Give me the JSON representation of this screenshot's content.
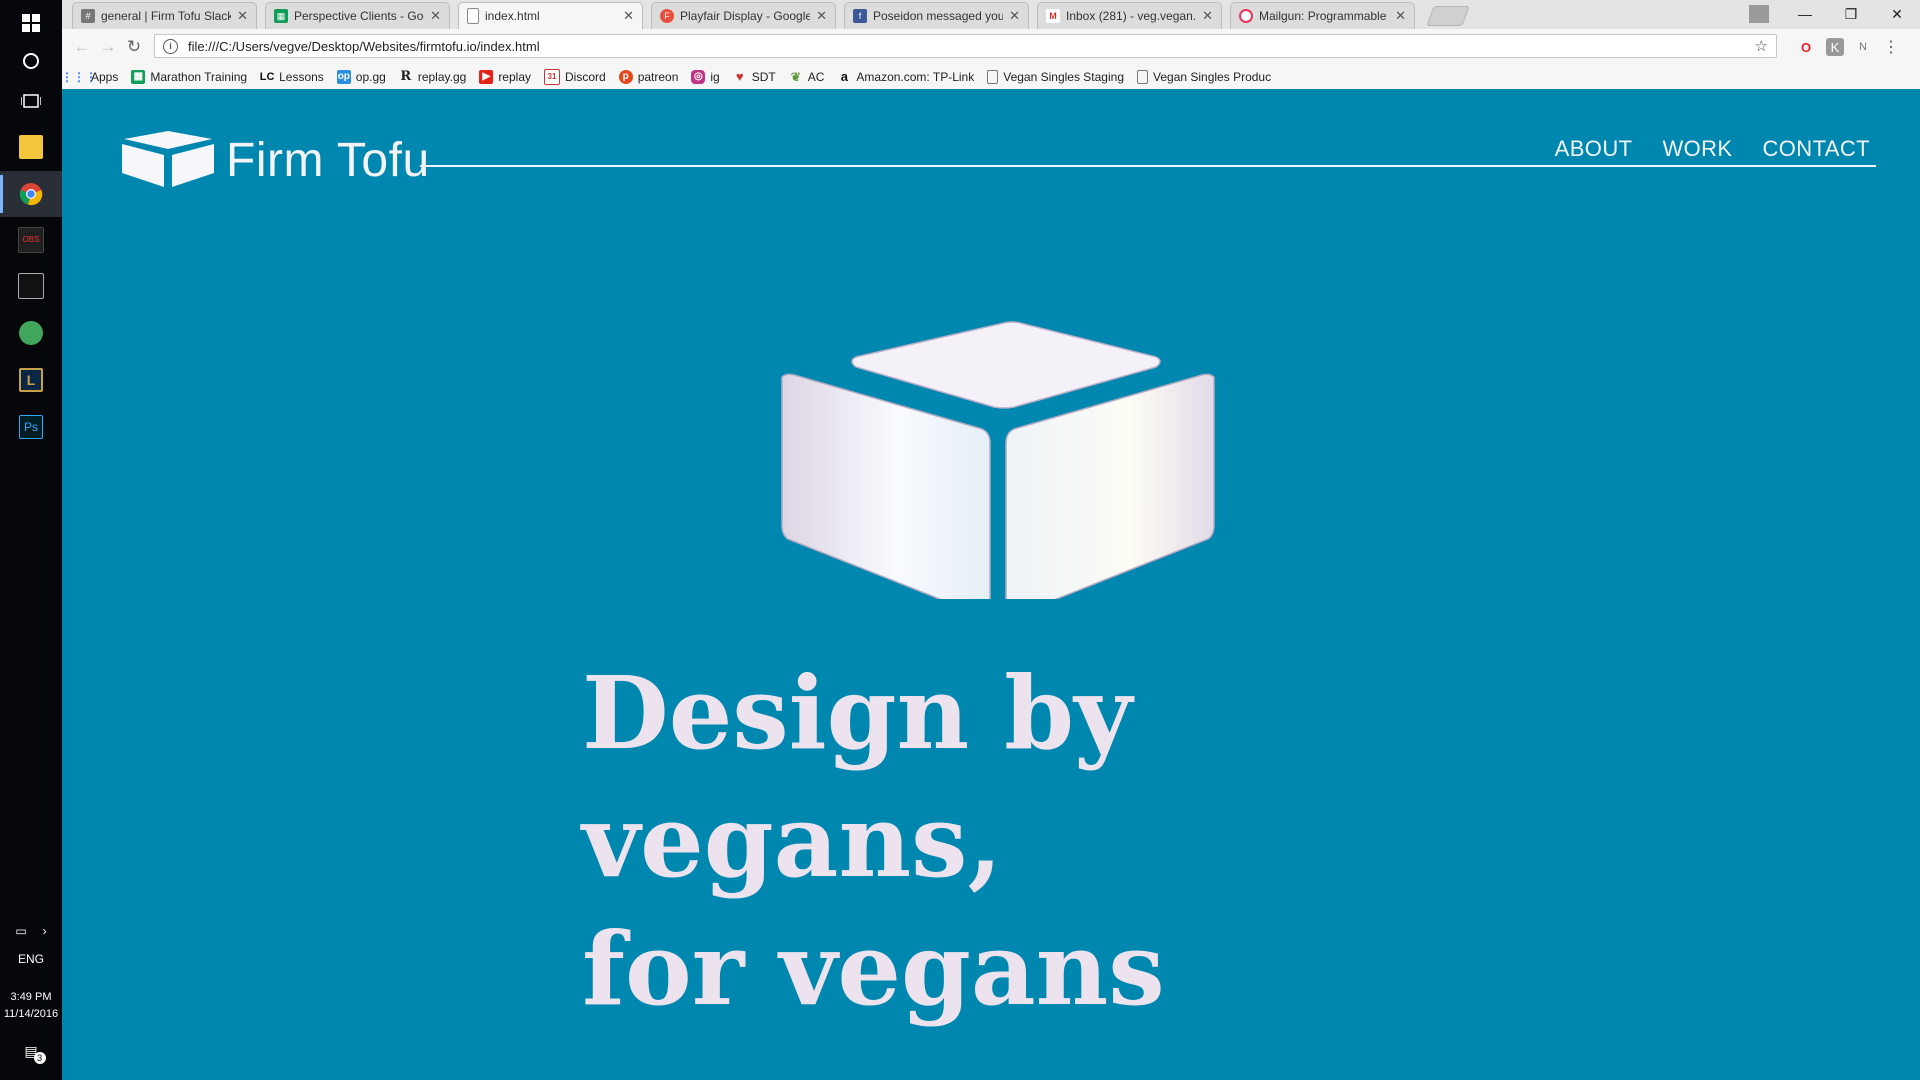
{
  "taskbar": {
    "tray": {
      "language": "ENG",
      "time": "3:49 PM",
      "date": "11/14/2016",
      "notification_count": "3"
    }
  },
  "browser": {
    "tabs": [
      {
        "title": "general | Firm Tofu Slack",
        "favicon": "slack-hash-icon",
        "active": false
      },
      {
        "title": "Perspective Clients - Goo",
        "favicon": "google-sheets-icon",
        "active": false
      },
      {
        "title": "index.html",
        "favicon": "file-icon",
        "active": true
      },
      {
        "title": "Playfair Display - Google",
        "favicon": "google-fonts-icon",
        "active": false
      },
      {
        "title": "Poseidon messaged you",
        "favicon": "facebook-icon",
        "active": false
      },
      {
        "title": "Inbox (281) - veg.vegan.",
        "favicon": "gmail-icon",
        "active": false
      },
      {
        "title": "Mailgun: Programmable",
        "favicon": "mailgun-icon",
        "active": false
      }
    ],
    "url": "file:///C:/Users/vegve/Desktop/Websites/firmtofu.io/index.html",
    "bookmarks": [
      {
        "label": "Apps",
        "icon": "apps-grid-icon"
      },
      {
        "label": "Marathon Training",
        "icon": "sheets-icon"
      },
      {
        "label": "Lessons",
        "icon": "lc-icon"
      },
      {
        "label": "op.gg",
        "icon": "opgg-icon"
      },
      {
        "label": "replay.gg",
        "icon": "replay-r-icon"
      },
      {
        "label": "replay",
        "icon": "youtube-icon"
      },
      {
        "label": "Discord",
        "icon": "calendar-icon"
      },
      {
        "label": "patreon",
        "icon": "patreon-icon"
      },
      {
        "label": "ig",
        "icon": "instagram-icon"
      },
      {
        "label": "SDT",
        "icon": "heart-icon"
      },
      {
        "label": "AC",
        "icon": "leaf-icon"
      },
      {
        "label": "Amazon.com: TP-Link",
        "icon": "amazon-icon"
      },
      {
        "label": "Vegan Singles Staging",
        "icon": "page-icon"
      },
      {
        "label": "Vegan Singles Produc",
        "icon": "page-icon"
      }
    ]
  },
  "site": {
    "brand": "Firm Tofu",
    "nav": [
      "ABOUT",
      "WORK",
      "CONTACT"
    ],
    "headline_line1": "Design by vegans,",
    "headline_line2": "for vegans"
  },
  "colors": {
    "page_bg": "#0087b0",
    "headline": "#ede3ee",
    "nav_text": "#f3f3f8"
  }
}
